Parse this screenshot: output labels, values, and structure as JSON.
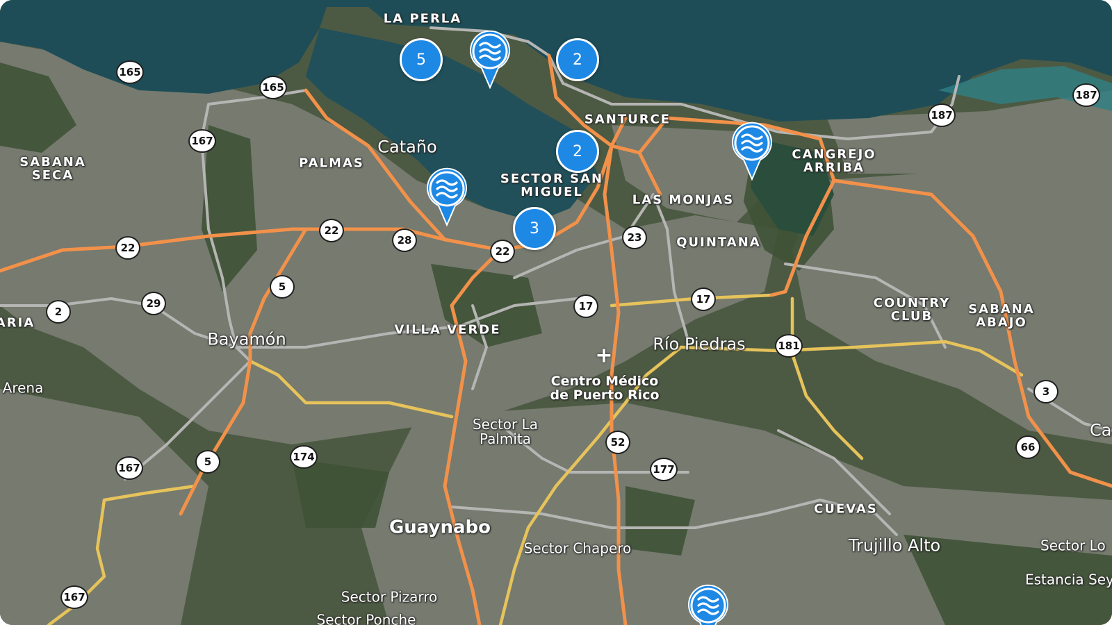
{
  "map": {
    "colors": {
      "ocean": "#1e4d57",
      "land": "#4d5a43",
      "urban": "#7d7f78",
      "highway": "#f2914a",
      "primary_road": "#e8c25a",
      "secondary_road": "#b4b4b4",
      "cluster": "#1e88e5",
      "pin": "#1e88e5"
    },
    "area_labels": [
      {
        "text": "LA PERLA"
      },
      {
        "text": "SANTURCE"
      },
      {
        "text": "CANGREJO\nARRIBA"
      },
      {
        "text": "SABANA\nSECA"
      },
      {
        "text": "PALMAS"
      },
      {
        "text": "SECTOR SAN\nMIGUEL"
      },
      {
        "text": "LAS MONJAS"
      },
      {
        "text": "QUINTANA"
      },
      {
        "text": "COUNTRY\nCLUB"
      },
      {
        "text": "SABANA\nABAJO"
      },
      {
        "text": "VILLA VERDE"
      },
      {
        "text": "ARIA"
      },
      {
        "text": "CUEVAS"
      }
    ],
    "city_labels": [
      {
        "text": "Cataño"
      },
      {
        "text": "Bayamón"
      },
      {
        "text": "Río Piedras"
      },
      {
        "text": "Guaynabo"
      },
      {
        "text": "Trujillo Alto"
      },
      {
        "text": "Carol"
      }
    ],
    "sector_labels": [
      {
        "text": "Sector La\nPalmita"
      },
      {
        "text": "Sector Chapero"
      },
      {
        "text": "Sector Pizarro"
      },
      {
        "text": "Sector Ponche"
      },
      {
        "text": "Arena"
      },
      {
        "text": "Sector Lo"
      },
      {
        "text": "Estancia Sey"
      }
    ],
    "poi": {
      "text": "Centro Médico\nde Puerto Rico",
      "icon": "hospital-plus-icon"
    },
    "route_shields": [
      "165",
      "165",
      "167",
      "187",
      "187",
      "22",
      "22",
      "28",
      "22",
      "23",
      "5",
      "29",
      "2",
      "17",
      "17",
      "181",
      "3",
      "66",
      "52",
      "177",
      "174",
      "5",
      "167",
      "167"
    ],
    "clusters": [
      {
        "count": "5"
      },
      {
        "count": "2"
      },
      {
        "count": "2"
      },
      {
        "count": "3"
      }
    ],
    "water_pins": [
      {
        "icon": "water-waves-icon"
      },
      {
        "icon": "water-waves-icon"
      },
      {
        "icon": "water-waves-icon"
      },
      {
        "icon": "water-waves-icon"
      }
    ]
  }
}
